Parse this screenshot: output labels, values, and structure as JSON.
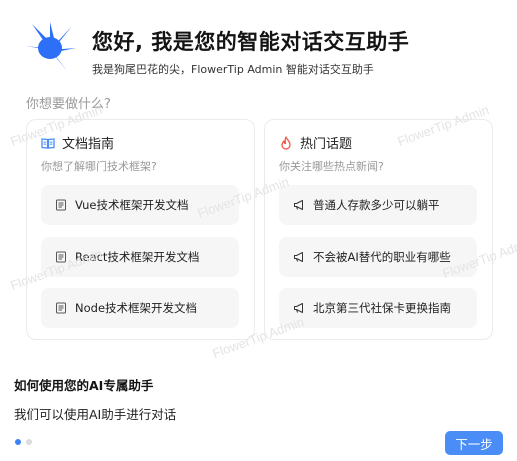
{
  "header": {
    "title": "您好, 我是您的智能对话交互助手",
    "subtitle": "我是狗尾巴花的尖，FlowerTip Admin 智能对话交互助手",
    "logo_color": "#2d6ff7"
  },
  "prompt_label": "你想要做什么?",
  "cards": [
    {
      "icon": "book-icon",
      "title": "文档指南",
      "subtitle": "你想了解哪门技术框架?",
      "items": [
        {
          "icon": "document-icon",
          "label": "Vue技术框架开发文档"
        },
        {
          "icon": "document-icon",
          "label": "React技术框架开发文档"
        },
        {
          "icon": "document-icon",
          "label": "Node技术框架开发文档"
        }
      ]
    },
    {
      "icon": "flame-icon",
      "title": "热门话题",
      "subtitle": "你关注哪些热点新闻?",
      "items": [
        {
          "icon": "megaphone-icon",
          "label": "普通人存款多少可以躺平"
        },
        {
          "icon": "megaphone-icon",
          "label": "不会被AI替代的职业有哪些"
        },
        {
          "icon": "megaphone-icon",
          "label": "北京第三代社保卡更换指南"
        }
      ]
    }
  ],
  "guide": {
    "title": "如何使用您的AI专属助手",
    "description": "我们可以使用AI助手进行对话"
  },
  "pager": {
    "total": 2,
    "current": 1
  },
  "next_button": "下一步",
  "watermark": "FlowerTip Admin",
  "colors": {
    "accent": "#4a8df7",
    "flame": "#f5564a"
  }
}
